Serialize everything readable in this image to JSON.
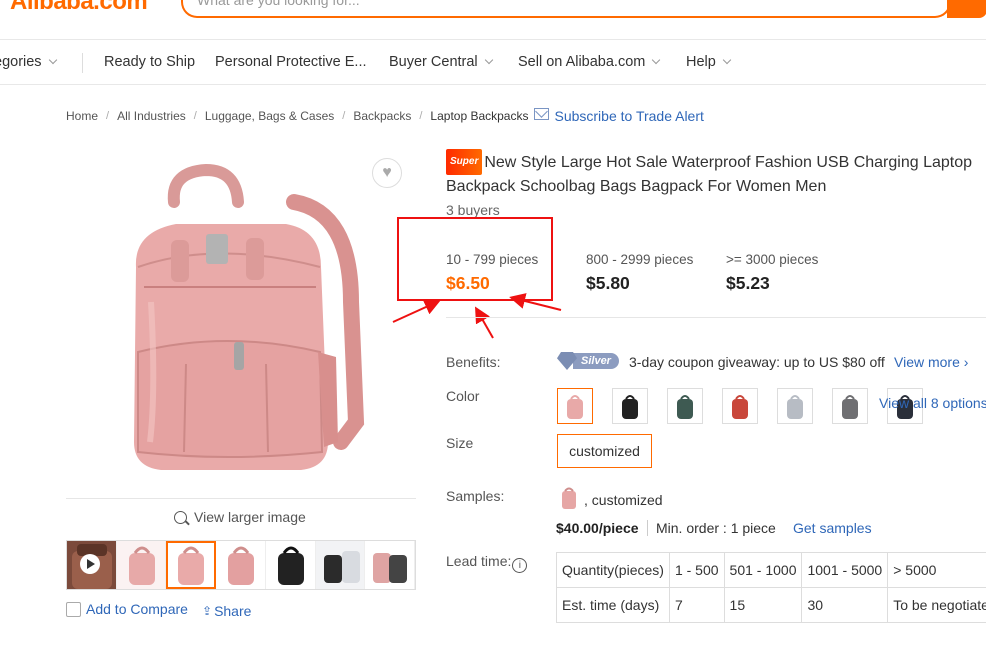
{
  "header": {
    "logo": "Alibaba.com",
    "search_placeholder": "What are you looking for..."
  },
  "nav": {
    "categories": "egories",
    "ready_to_ship": "Ready to Ship",
    "ppe": "Personal Protective E...",
    "buyer_central": "Buyer Central",
    "sell": "Sell on Alibaba.com",
    "help": "Help"
  },
  "breadcrumb": {
    "items": [
      "Home",
      "All Industries",
      "Luggage, Bags & Cases",
      "Backpacks"
    ],
    "current": "Laptop Backpacks",
    "subscribe": "Subscribe to Trade Alert"
  },
  "gallery": {
    "view_larger": "View larger image",
    "add_to_compare": "Add to Compare",
    "share": "Share"
  },
  "product": {
    "badge": "Super",
    "title": "New Style Large Hot Sale Waterproof Fashion USB Charging Laptop Backpack Schoolbag Bags Bagpack For Women Men",
    "buyers": "3 buyers",
    "price_tiers": [
      {
        "qty": "10 - 799 pieces",
        "price": "$6.50"
      },
      {
        "qty": "800 - 2999 pieces",
        "price": "$5.80"
      },
      {
        "qty": ">= 3000 pieces",
        "price": "$5.23"
      }
    ]
  },
  "benefits": {
    "label": "Benefits:",
    "tier": "Silver",
    "text": "3-day coupon giveaway: up to US $80 off",
    "view_more": "View more"
  },
  "color": {
    "label": "Color",
    "swatches": [
      "pink",
      "black",
      "dark-green",
      "red",
      "light-grey",
      "grey",
      "navy"
    ],
    "swatch_colors": [
      "#e8a9a8",
      "#222222",
      "#3e5a52",
      "#c9473b",
      "#b7bcc4",
      "#6f6f72",
      "#2a2f3a"
    ],
    "view_all": "View all 8 options"
  },
  "size": {
    "label": "Size",
    "value": "customized"
  },
  "samples": {
    "label": "Samples:",
    "text": ", customized",
    "price": "$40.00/piece",
    "min_order": "Min. order : 1 piece",
    "get_samples": "Get samples"
  },
  "lead_time": {
    "label": "Lead time:",
    "rows": [
      [
        "Quantity(pieces)",
        "1 - 500",
        "501 - 1000",
        "1001 - 5000",
        "> 5000"
      ],
      [
        "Est. time (days)",
        "7",
        "15",
        "30",
        "To be negotiated"
      ]
    ]
  },
  "colors": {
    "accent": "#ff6a00",
    "link": "#2f67b8",
    "annotation": "#e11111"
  }
}
